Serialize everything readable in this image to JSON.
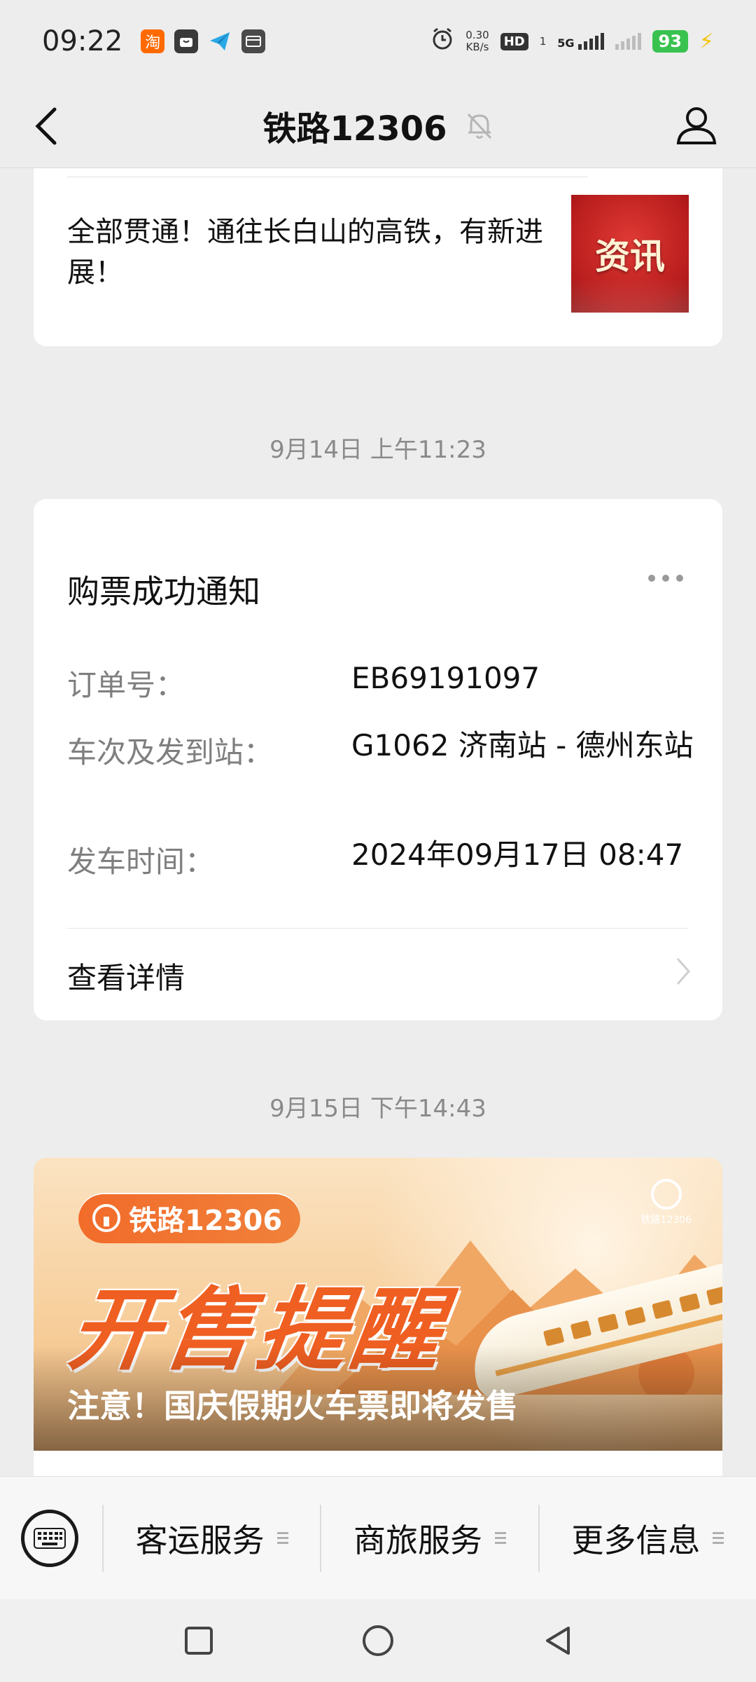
{
  "status_bar": {
    "time": "09:22",
    "app_taobao": "淘",
    "net_speed_value": "0.30",
    "net_speed_unit": "KB/s",
    "hd_label": "HD",
    "hd_sub": "1",
    "network_type": "5G",
    "battery": "93"
  },
  "header": {
    "title": "铁路12306"
  },
  "article": {
    "title": "全部贯通！通往长白山的高铁，有新进展！",
    "thumb_label": "资讯"
  },
  "timestamps": {
    "first": "9月14日 上午11:23",
    "second": "9月15日 下午14:43"
  },
  "ticket": {
    "title": "购票成功通知",
    "order_label": "订单号：",
    "order_value": "EB69191097",
    "train_label": "车次及发到站：",
    "train_value": "G1062  济南站 - 德州东站",
    "time_label": "发车时间：",
    "time_value": "2024年09月17日 08:47",
    "detail_link": "查看详情"
  },
  "banner": {
    "brand": "铁路12306",
    "corner_brand": "铁路12306",
    "headline": "开售提醒",
    "caption": "注意！国庆假期火车票即将发售"
  },
  "menu": {
    "items": [
      {
        "label": "客运服务"
      },
      {
        "label": "商旅服务"
      },
      {
        "label": "更多信息"
      }
    ]
  },
  "colors": {
    "accent_orange": "#ef5f22",
    "thumb_red": "#b71c1c",
    "battery_green": "#39c24f"
  }
}
